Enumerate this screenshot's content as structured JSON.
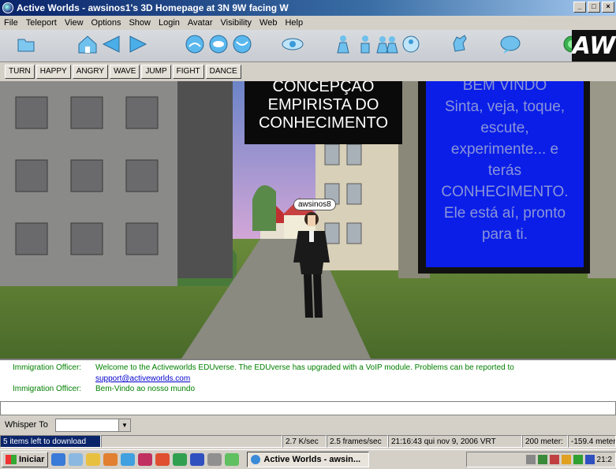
{
  "window": {
    "title": "Active Worlds - awsinos1's 3D Homepage at 3N 9W facing W",
    "min": "_",
    "max": "□",
    "close": "×"
  },
  "menu": [
    "File",
    "Teleport",
    "View",
    "Options",
    "Show",
    "Login",
    "Avatar",
    "Visibility",
    "Web",
    "Help"
  ],
  "gestures": [
    "TURN",
    "HAPPY",
    "ANGRY",
    "WAVE",
    "JUMP",
    "FIGHT",
    "DANCE"
  ],
  "scene": {
    "sign_left": [
      "CONCEPÇÃO",
      "EMPIRISTA DO",
      "CONHECIMENTO"
    ],
    "sign_right": [
      "BEM VINDO",
      "Sinta, veja, toque,",
      "escute,",
      "experimente... e",
      "terás",
      "CONHECIMENTO.",
      "Ele está aí, pronto",
      "para ti."
    ],
    "avatar_tag": "awsinos8"
  },
  "chat": [
    {
      "who": "Immigration Officer:",
      "msg": "Welcome to the Activeworlds EDUverse. The EDUverse has upgraded with a VoIP module.  Problems can be reported to"
    },
    {
      "who": "",
      "msg": "support@activeworlds.com"
    },
    {
      "who": "Immigration Officer:",
      "msg": "Bem-Vindo ao nosso mundo"
    }
  ],
  "whisper": {
    "label": "Whisper To"
  },
  "status": {
    "download": "5 items left to download",
    "rate": "2.7 K/sec",
    "fps": "2.5 frames/sec",
    "time": "21:16:43 qui nov 9, 2006 VRT",
    "distance": "200 meter:",
    "coord": "-159.4 meter"
  },
  "taskbar": {
    "start": "Iniciar",
    "task": "Active Worlds - awsin...",
    "clock": "21:2"
  },
  "toolbar_logo": "AW",
  "colors": {
    "title_start": "#0a246a",
    "sign_blue": "#0a1ee8",
    "chat_green": "#008000"
  }
}
